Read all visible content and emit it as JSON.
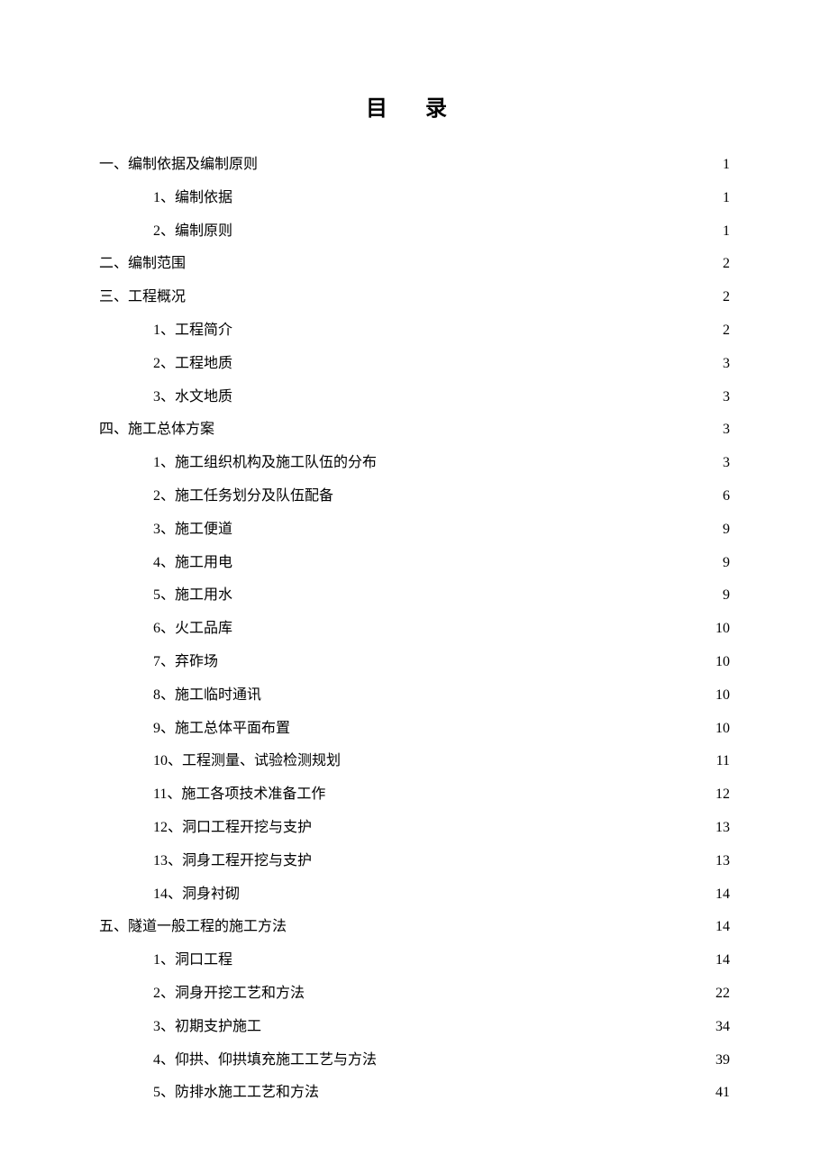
{
  "title": "目  录",
  "entries": [
    {
      "level": 1,
      "label": "一、编制依据及编制原则",
      "page": "1"
    },
    {
      "level": 2,
      "label": "1、编制依据",
      "page": "1"
    },
    {
      "level": 2,
      "label": "2、编制原则",
      "page": "1"
    },
    {
      "level": 1,
      "label": "二、编制范围",
      "page": "2"
    },
    {
      "level": 1,
      "label": "三、工程概况",
      "page": "2"
    },
    {
      "level": 2,
      "label": "1、工程简介",
      "page": "2"
    },
    {
      "level": 2,
      "label": "2、工程地质",
      "page": "3"
    },
    {
      "level": 2,
      "label": "3、水文地质",
      "page": "3"
    },
    {
      "level": 1,
      "label": "四、施工总体方案",
      "page": "3"
    },
    {
      "level": 2,
      "label": "1、施工组织机构及施工队伍的分布",
      "page": "3"
    },
    {
      "level": 2,
      "label": "2、施工任务划分及队伍配备",
      "page": "6"
    },
    {
      "level": 2,
      "label": "3、施工便道",
      "page": "9"
    },
    {
      "level": 2,
      "label": "4、施工用电",
      "page": "9"
    },
    {
      "level": 2,
      "label": "5、施工用水",
      "page": "9"
    },
    {
      "level": 2,
      "label": "6、火工品库",
      "page": "10"
    },
    {
      "level": 2,
      "label": "7、弃砟场",
      "page": "10"
    },
    {
      "level": 2,
      "label": "8、施工临时通讯",
      "page": "10"
    },
    {
      "level": 2,
      "label": "9、施工总体平面布置",
      "page": "10"
    },
    {
      "level": 2,
      "label": "10、工程测量、试验检测规划",
      "page": "11"
    },
    {
      "level": 2,
      "label": "11、施工各项技术准备工作",
      "page": "12"
    },
    {
      "level": 2,
      "label": "12、洞口工程开挖与支护",
      "page": "13"
    },
    {
      "level": 2,
      "label": "13、洞身工程开挖与支护",
      "page": "13"
    },
    {
      "level": 2,
      "label": "14、洞身衬砌",
      "page": "14"
    },
    {
      "level": 1,
      "label": "五、隧道一般工程的施工方法",
      "page": "14"
    },
    {
      "level": 2,
      "label": "1、洞口工程",
      "page": "14"
    },
    {
      "level": 2,
      "label": "2、洞身开挖工艺和方法",
      "page": "22"
    },
    {
      "level": 2,
      "label": "3、初期支护施工",
      "page": "34"
    },
    {
      "level": 2,
      "label": "4、仰拱、仰拱填充施工工艺与方法",
      "page": "39"
    },
    {
      "level": 2,
      "label": "5、防排水施工工艺和方法",
      "page": "41"
    }
  ]
}
